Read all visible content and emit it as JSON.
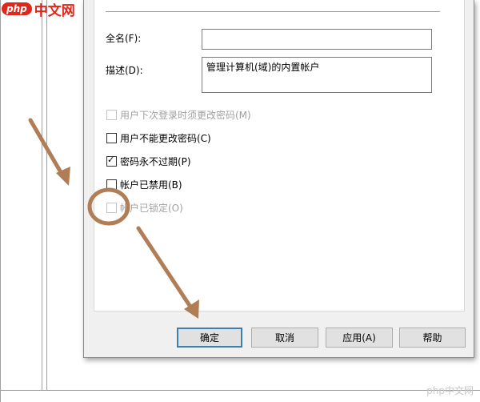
{
  "logo": {
    "badge": "php",
    "text": "中文网"
  },
  "fields": {
    "fullname_label": "全名(F):",
    "fullname_value": "",
    "description_label": "描述(D):",
    "description_value": "管理计算机(域)的内置帐户"
  },
  "checkboxes": [
    {
      "label": "用户下次登录时须更改密码(M)",
      "checked": false,
      "enabled": false
    },
    {
      "label": "用户不能更改密码(C)",
      "checked": false,
      "enabled": true
    },
    {
      "label": "密码永不过期(P)",
      "checked": true,
      "enabled": true
    },
    {
      "label": "帐户已禁用(B)",
      "checked": false,
      "enabled": true
    },
    {
      "label": "帐户已锁定(O)",
      "checked": false,
      "enabled": false
    }
  ],
  "buttons": {
    "ok": "确定",
    "cancel": "取消",
    "apply": "应用(A)",
    "help": "帮助"
  },
  "watermark": "php中文网",
  "annotation_color": "#b07d56"
}
